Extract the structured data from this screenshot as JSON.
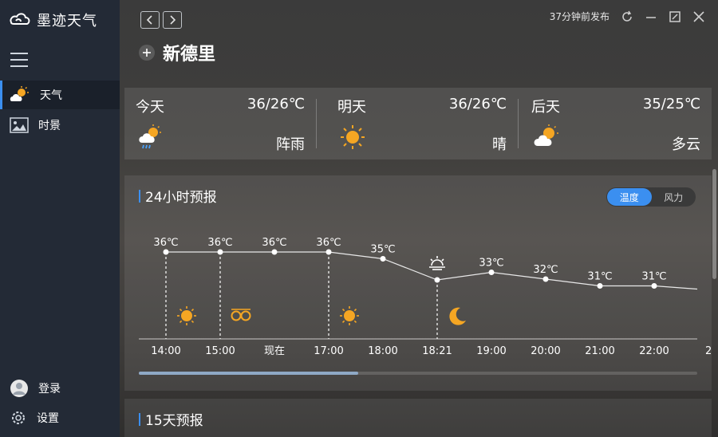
{
  "app": {
    "name": "墨迹天气"
  },
  "sidebar": {
    "items": [
      {
        "label": "天气",
        "icon": "sun-cloud-icon",
        "active": true
      },
      {
        "label": "时景",
        "icon": "picture-icon",
        "active": false
      }
    ],
    "login_label": "登录",
    "settings_label": "设置"
  },
  "header": {
    "publish_time": "37分钟前发布",
    "city": "新德里"
  },
  "forecast": [
    {
      "day": "今天",
      "temp": "36/26℃",
      "condition": "阵雨",
      "icon": "shower-icon"
    },
    {
      "day": "明天",
      "temp": "36/26℃",
      "condition": "晴",
      "icon": "sun-icon"
    },
    {
      "day": "后天",
      "temp": "35/25℃",
      "condition": "多云",
      "icon": "cloud-sun-icon"
    }
  ],
  "hourly": {
    "title": "24小时预报",
    "toggle": {
      "temp": "温度",
      "wind": "风力",
      "active": "温度"
    },
    "chart_data": {
      "type": "line",
      "x": [
        "14:00",
        "15:00",
        "现在",
        "17:00",
        "18:00",
        "18:21",
        "19:00",
        "20:00",
        "21:00",
        "22:00"
      ],
      "y": [
        36,
        36,
        36,
        36,
        35,
        null,
        33,
        32,
        31,
        31
      ],
      "labels": [
        "36℃",
        "36℃",
        "36℃",
        "36℃",
        "35℃",
        "",
        "33℃",
        "32℃",
        "31℃",
        "31℃"
      ],
      "sunset_index": 5,
      "condition_icons": [
        {
          "index": 0,
          "icon": "sun-icon"
        },
        {
          "index": 1,
          "icon": "haze-icon"
        },
        {
          "index": 3,
          "icon": "sun-icon"
        },
        {
          "index": 5,
          "icon": "moon-icon"
        }
      ],
      "dashed_markers": [
        0,
        1,
        3,
        5
      ],
      "next_tick_partial": "2"
    }
  },
  "daily15": {
    "title": "15天预报"
  },
  "colors": {
    "accent": "#3b8ff0",
    "sun": "#f5a623"
  }
}
